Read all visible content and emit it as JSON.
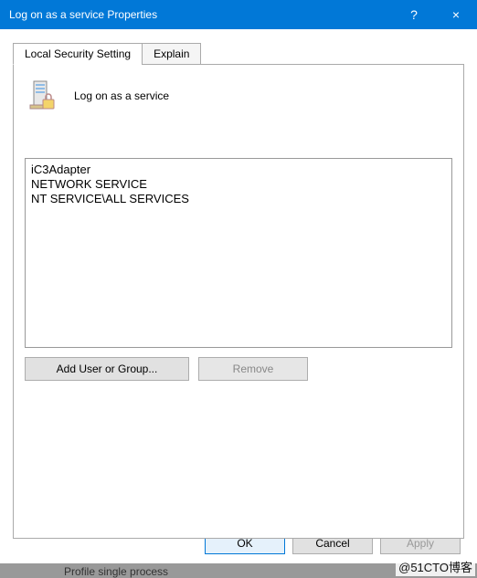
{
  "titlebar": {
    "title": "Log on as a service Properties",
    "help": "?",
    "close": "×"
  },
  "tabs": {
    "local": "Local Security Setting",
    "explain": "Explain"
  },
  "policy": {
    "title": "Log on as a service"
  },
  "users": {
    "items": [
      "iC3Adapter",
      "NETWORK SERVICE",
      "NT SERVICE\\ALL SERVICES"
    ]
  },
  "buttons": {
    "add": "Add User or Group...",
    "remove": "Remove",
    "ok": "OK",
    "cancel": "Cancel",
    "apply": "Apply"
  },
  "watermark": "@51CTO博客",
  "bg_text": "Profile single process"
}
